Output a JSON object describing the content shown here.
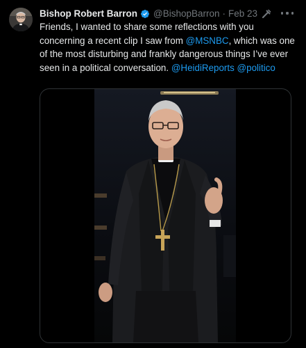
{
  "tweet": {
    "author_name": "Bishop Robert Barron",
    "handle": "@BishopBarron",
    "separator": "·",
    "date": "Feb 23",
    "text_parts": [
      {
        "text": "Friends, I wanted to share some reflections with you concerning a recent clip I saw from ",
        "type": "plain"
      },
      {
        "text": "@MSNBC",
        "type": "mention"
      },
      {
        "text": ", which was one of the most disturbing and frankly dangerous things I’ve ever seen in a political conversation. ",
        "type": "plain"
      },
      {
        "text": "@HeidiReports",
        "type": "mention"
      },
      {
        "text": " ",
        "type": "plain"
      },
      {
        "text": "@politico",
        "type": "mention"
      }
    ],
    "verified": true,
    "accent_color": "#1d9bf0"
  },
  "icons": {
    "verified": "verified-badge-icon",
    "grok": "grok-icon",
    "more": "more-options-icon"
  },
  "media": {
    "type": "video"
  }
}
